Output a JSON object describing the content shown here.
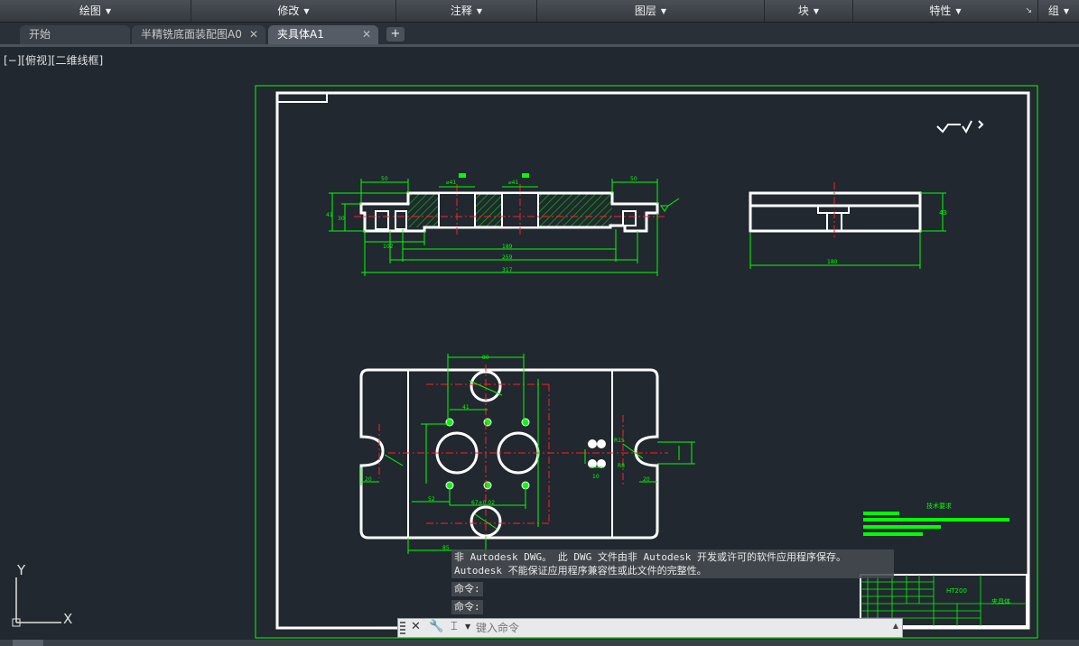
{
  "ribbon": {
    "panels": [
      "绘图",
      "修改",
      "注释",
      "图层",
      "块",
      "特性",
      "组"
    ],
    "launcher_icon": "dialog-launcher-icon"
  },
  "tabs": [
    {
      "label": "开始",
      "closable": false,
      "active": false
    },
    {
      "label": "半精铣底面装配图A0",
      "closable": true,
      "active": false
    },
    {
      "label": "夹具体A1",
      "closable": true,
      "active": true
    }
  ],
  "tab_add_label": "+",
  "viewport": {
    "view_label": "[−][俯视][二维线框]"
  },
  "drawing": {
    "colors": {
      "background": "#212830",
      "outline": "#ffffff",
      "dimension": "#00ff00",
      "centerline": "#ff2020",
      "border": "#00ff00"
    },
    "front_view_dims": {
      "d1": "50",
      "d2": "⌀41",
      "d3": "⌀41",
      "d4": "50",
      "d5": "102",
      "d6": "189",
      "d7": "259",
      "d8": "317",
      "d9": "41",
      "d10": "30"
    },
    "side_view_dims": {
      "width": "180",
      "height": "43"
    },
    "top_view_dims": {
      "d1": "80",
      "d2": "41",
      "d3": "52",
      "d4": "67±0.02",
      "d5": "85",
      "d6": "20",
      "d7": "20",
      "d8": "R15",
      "d9": "R8",
      "d10": "10"
    },
    "title_block": {
      "material": "HT200",
      "part_name": "夹具体"
    },
    "tech_req_title": "技术要求"
  },
  "ucs": {
    "x_label": "X",
    "y_label": "Y"
  },
  "command": {
    "history": [
      "非 Autodesk DWG。 此 DWG 文件由非 Autodesk 开发或许可的软件应用程序保存。",
      "Autodesk 不能保证应用程序兼容性或此文件的完整性。"
    ],
    "prompts": [
      "命令:",
      "命令:"
    ],
    "placeholder": "键入命令"
  }
}
